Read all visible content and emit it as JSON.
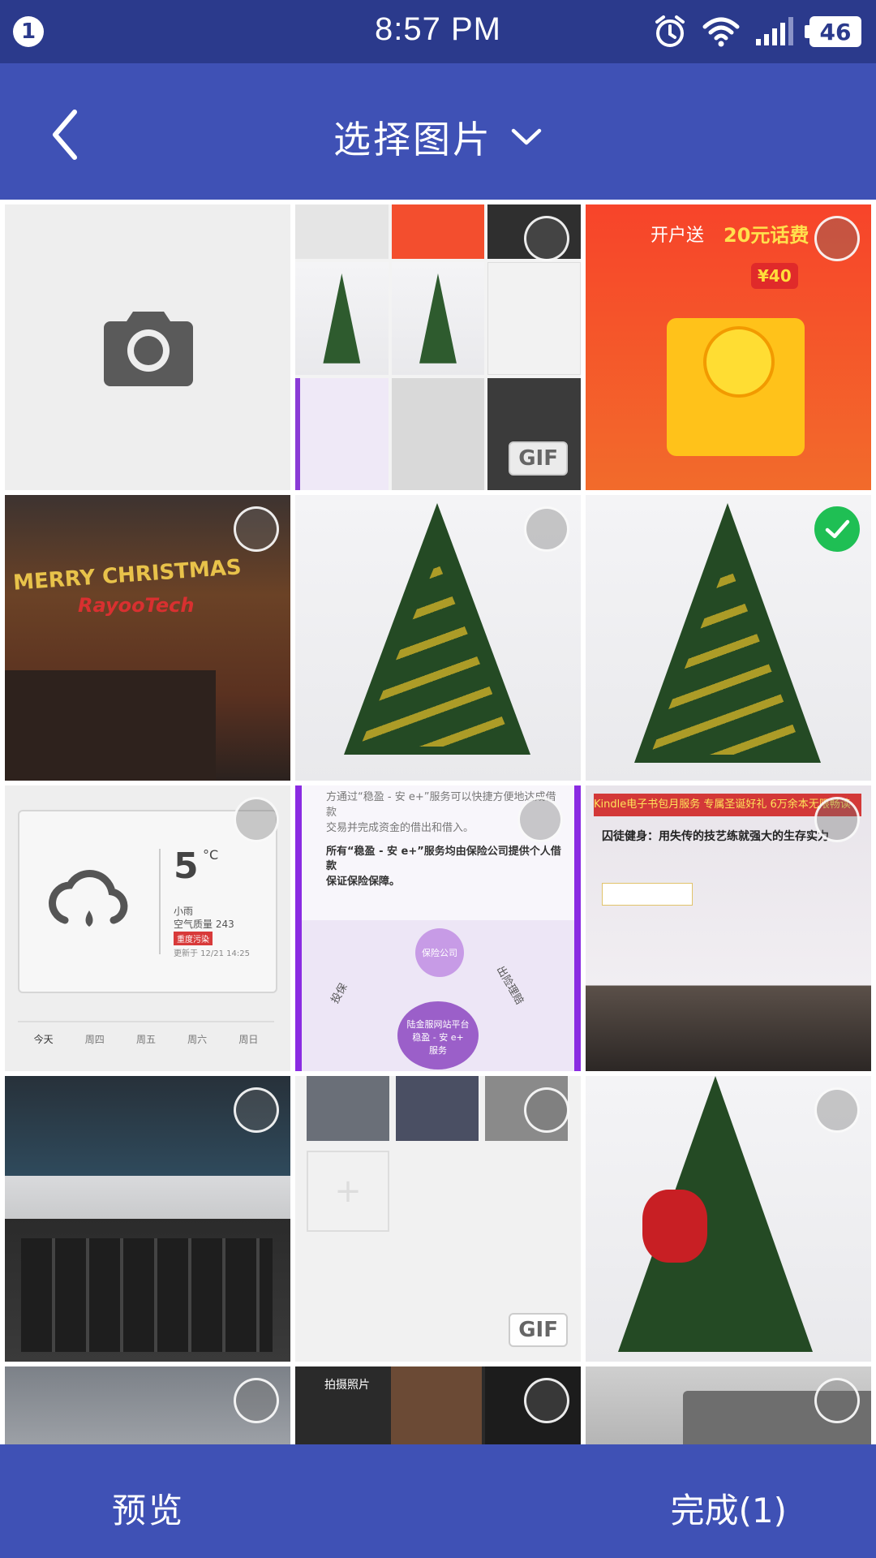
{
  "status_bar": {
    "notification_count": "1",
    "time": "8:57 PM",
    "battery": "46"
  },
  "toolbar": {
    "title": "选择图片"
  },
  "grid": {
    "cells": [
      {
        "type": "camera",
        "selected": false
      },
      {
        "type": "screenshot-collage",
        "selected": false,
        "gif": "GIF"
      },
      {
        "type": "promo",
        "selected": false,
        "promo_text_a": "开户送",
        "promo_text_b": "20元话费",
        "coupon": "¥40"
      },
      {
        "type": "office-christmas",
        "selected": false,
        "sign_a": "MERRY CHRISTMAS",
        "sign_b": "RayooTech"
      },
      {
        "type": "christmas-tree",
        "selected": false
      },
      {
        "type": "christmas-tree",
        "selected": true
      },
      {
        "type": "weather-card",
        "selected": false,
        "temp": "5",
        "unit": "°C",
        "city": "小雨",
        "aqi": "空气质量 243",
        "badge": "重度污染",
        "updated": "更新于 12/21 14:25",
        "days": [
          "今天",
          "周四",
          "周五",
          "周六",
          "周日"
        ]
      },
      {
        "type": "article-diagram",
        "selected": false,
        "line1": "方通过“稳盈 - 安 e+”服务可以快捷方便地达成借款",
        "line2": "交易并完成资金的借出和借入。",
        "line3": "所有“稳盈 - 安 e+”服务均由保险公司提供个人借款",
        "line4": "保证保险保障。",
        "node_top": "保险公司",
        "node_mid": "陆金服网站平台",
        "node_mid2": "稳盈 - 安 e+",
        "node_mid3": "服务",
        "label_left": "投保",
        "label_right": "出险理赔"
      },
      {
        "type": "laptop-screen",
        "selected": false,
        "banner": "Kindle电子书包月服务 专属圣诞好礼 6万余本无限畅读",
        "heading": "囚徒健身：用失传的技艺练就强大的生存实力"
      },
      {
        "type": "laptop-keyboard",
        "selected": false
      },
      {
        "type": "photo-collage",
        "selected": false,
        "gif": "GIF"
      },
      {
        "type": "christmas-tree",
        "selected": false
      },
      {
        "type": "office-ceiling",
        "selected": false
      },
      {
        "type": "food-collage",
        "selected": false,
        "caption": "拍摄照片"
      },
      {
        "type": "laptop-top",
        "selected": false
      }
    ]
  },
  "bottom_bar": {
    "preview_label": "预览",
    "done_label": "完成(1)"
  },
  "colors": {
    "status_bar": "#2b3a8c",
    "primary": "#3f51b5",
    "selected_check": "#1fbf54"
  }
}
